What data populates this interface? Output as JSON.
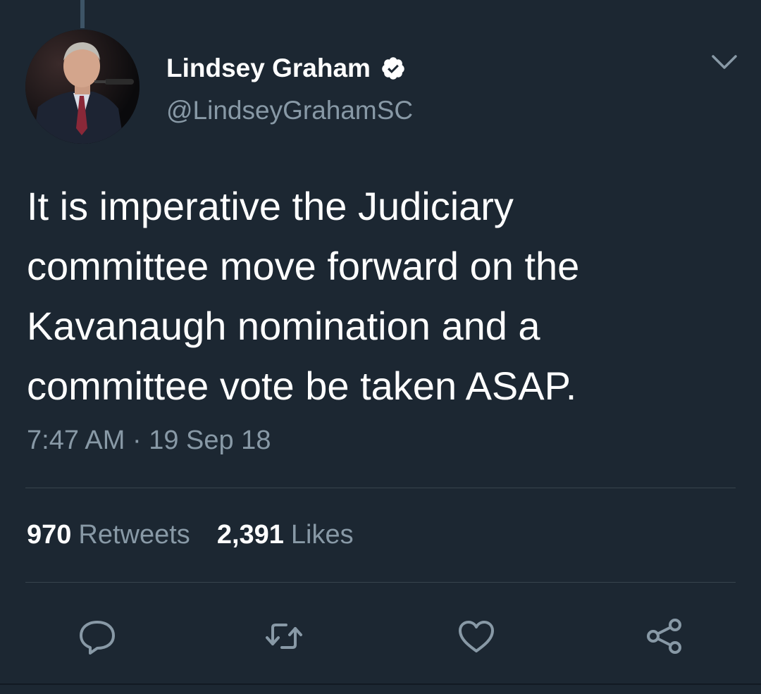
{
  "author": {
    "display_name": "Lindsey Graham",
    "handle": "@LindseyGrahamSC",
    "verified": true
  },
  "tweet": {
    "lines": [
      "It is imperative the Judiciary",
      "committee move forward on the",
      "Kavanaugh nomination and a",
      "committee vote be taken ASAP."
    ],
    "timestamp": "7:47 AM · 19 Sep 18"
  },
  "stats": {
    "retweets_count": "970",
    "retweets_label": "Retweets",
    "likes_count": "2,391",
    "likes_label": "Likes"
  },
  "actions": {
    "icons": [
      "reply-icon",
      "retweet-icon",
      "like-icon",
      "share-icon"
    ]
  },
  "colors": {
    "background": "#1c2732",
    "primary_text": "#ffffff",
    "secondary_text": "#8899a6",
    "divider": "#38444d",
    "verified_badge": "#ffffff"
  }
}
